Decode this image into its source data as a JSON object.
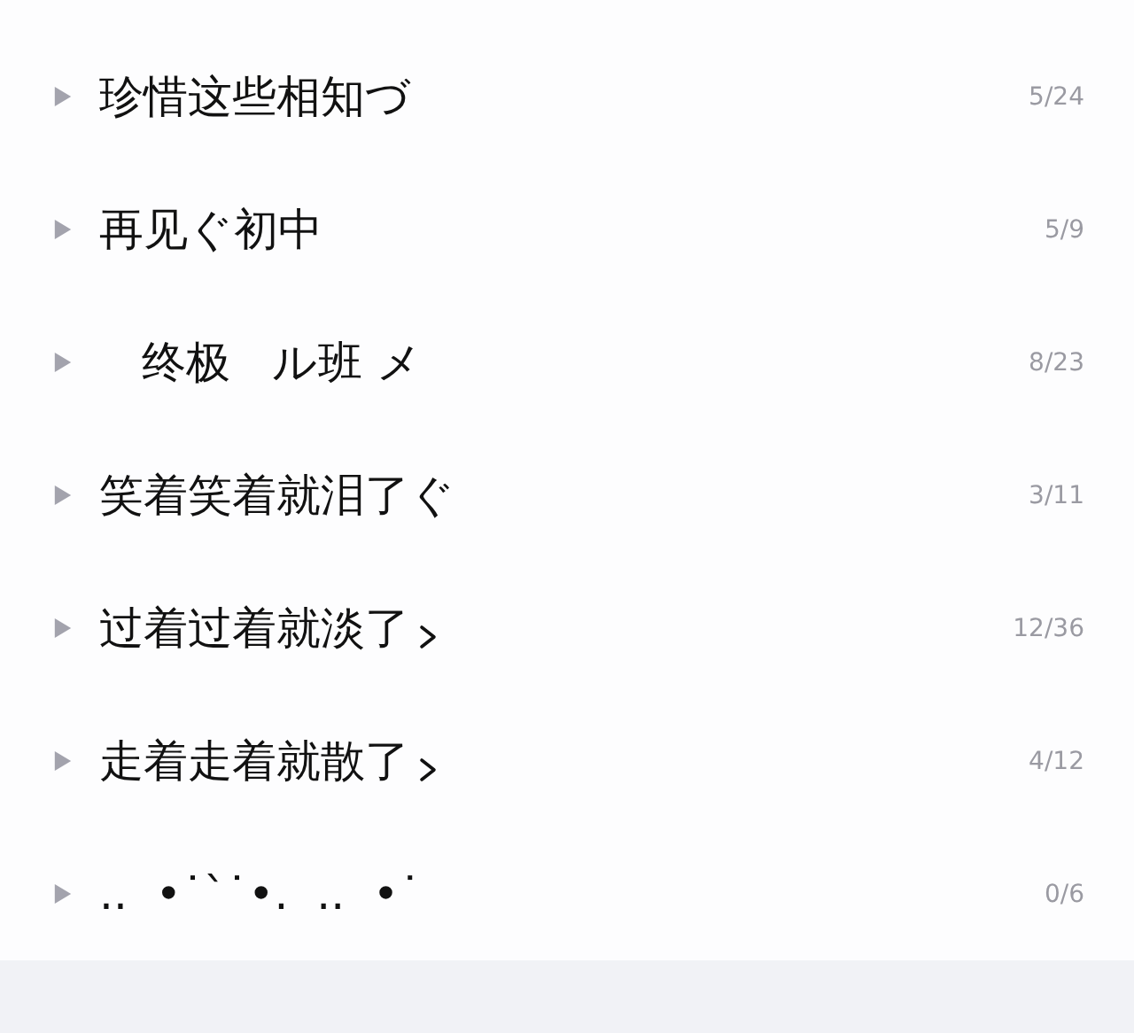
{
  "groups": [
    {
      "name": "珍惜这些相知づ",
      "count": "5/24",
      "expanded": false
    },
    {
      "name": "再见ぐ初中",
      "count": "5/9",
      "expanded": false
    },
    {
      "name": "   终极   ル班 メ",
      "count": "8/23",
      "expanded": false
    },
    {
      "name": "笑着笑着就泪了ぐ",
      "count": "3/11",
      "expanded": false
    },
    {
      "name": "过着过着就淡了",
      "suffix_mark": true,
      "count": "12/36",
      "expanded": false
    },
    {
      "name": "走着走着就散了",
      "suffix_mark": true,
      "count": "4/12",
      "expanded": false
    },
    {
      "name": "..  •˙ˋ˙•.  ..  •˙",
      "count": "0/6",
      "expanded": false
    }
  ]
}
